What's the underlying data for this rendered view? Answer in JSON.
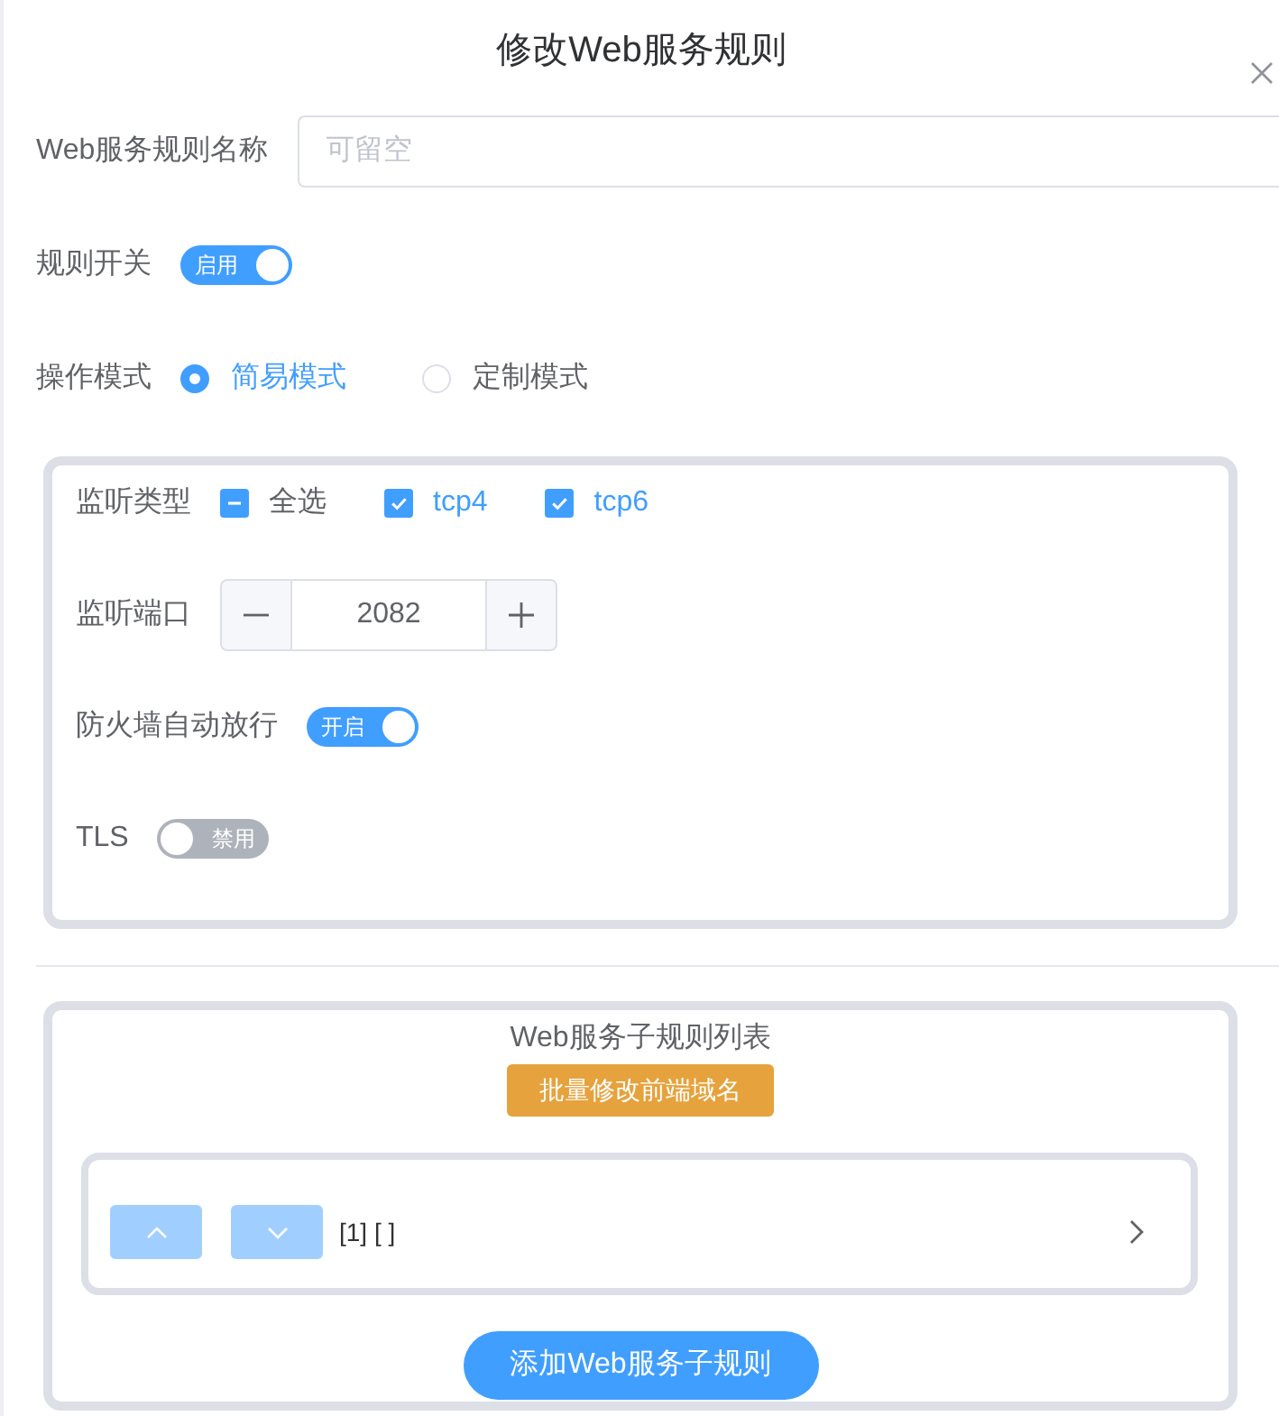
{
  "dialog": {
    "title": "修改Web服务规则"
  },
  "name_field": {
    "label": "Web服务规则名称",
    "placeholder": "可留空"
  },
  "rule_switch": {
    "label": "规则开关",
    "on": true,
    "text": "启用"
  },
  "mode": {
    "label": "操作模式",
    "options": [
      {
        "label": "简易模式",
        "selected": true
      },
      {
        "label": "定制模式",
        "selected": false
      }
    ]
  },
  "listen": {
    "type_label": "监听类型",
    "select_all": {
      "label": "全选",
      "indeterminate": true
    },
    "types": [
      {
        "label": "tcp4",
        "checked": true
      },
      {
        "label": "tcp6",
        "checked": true
      }
    ],
    "port_label": "监听端口",
    "port_value": "2082",
    "switches": [
      {
        "label": "防火墙自动放行",
        "on": true,
        "text": "开启"
      },
      {
        "label": "TLS",
        "on": false,
        "text": "禁用"
      }
    ]
  },
  "subrules": {
    "title": "Web服务子规则列表",
    "batch_button": "批量修改前端域名",
    "items": [
      {
        "text": "[1] [ ]",
        "up_disabled": true,
        "down_disabled": true
      }
    ],
    "add_button": "添加Web服务子规则"
  }
}
